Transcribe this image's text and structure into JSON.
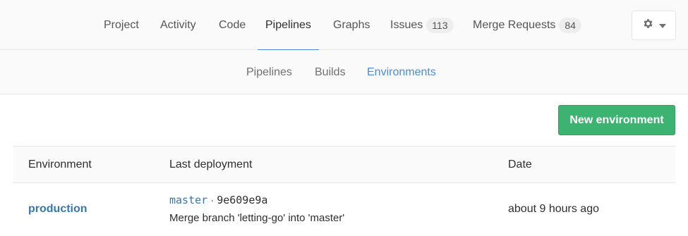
{
  "main_nav": {
    "tabs": [
      {
        "label": "Project"
      },
      {
        "label": "Activity"
      },
      {
        "label": "Code"
      },
      {
        "label": "Pipelines"
      },
      {
        "label": "Graphs"
      },
      {
        "label": "Issues",
        "count": "113"
      },
      {
        "label": "Merge Requests",
        "count": "84"
      }
    ],
    "active_tab": "Pipelines",
    "settings_icon": "gear-icon",
    "dropdown_icon": "caret-down-icon"
  },
  "sub_nav": {
    "tabs": [
      {
        "label": "Pipelines"
      },
      {
        "label": "Builds"
      },
      {
        "label": "Environments"
      }
    ],
    "active_tab": "Environments"
  },
  "actions": {
    "new_environment_label": "New environment"
  },
  "table": {
    "headers": [
      "Environment",
      "Last deployment",
      "Date"
    ],
    "rows": [
      {
        "environment": "production",
        "ref": "master",
        "separator": "·",
        "sha": "9e609e9a",
        "message": "Merge branch 'letting-go' into 'master'",
        "date": "about 9 hours ago"
      }
    ]
  },
  "colors": {
    "accent": "#4a8bdb",
    "link": "#3777b0",
    "button_green": "#3cb371",
    "nav_bg": "#fafafa",
    "border": "#e5e5e5"
  }
}
